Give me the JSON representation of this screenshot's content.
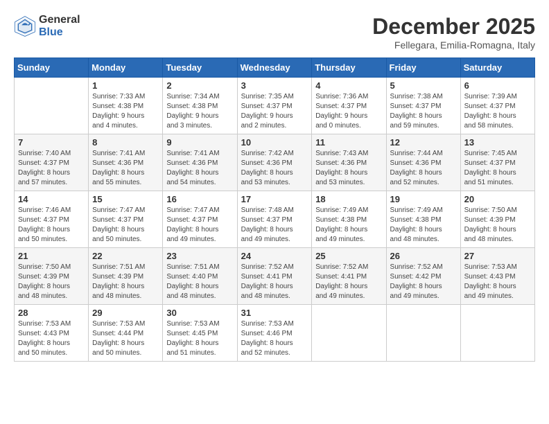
{
  "header": {
    "logo_general": "General",
    "logo_blue": "Blue",
    "month_title": "December 2025",
    "location": "Fellegara, Emilia-Romagna, Italy"
  },
  "weekdays": [
    "Sunday",
    "Monday",
    "Tuesday",
    "Wednesday",
    "Thursday",
    "Friday",
    "Saturday"
  ],
  "weeks": [
    [
      {
        "day": "",
        "info": ""
      },
      {
        "day": "1",
        "info": "Sunrise: 7:33 AM\nSunset: 4:38 PM\nDaylight: 9 hours\nand 4 minutes."
      },
      {
        "day": "2",
        "info": "Sunrise: 7:34 AM\nSunset: 4:38 PM\nDaylight: 9 hours\nand 3 minutes."
      },
      {
        "day": "3",
        "info": "Sunrise: 7:35 AM\nSunset: 4:37 PM\nDaylight: 9 hours\nand 2 minutes."
      },
      {
        "day": "4",
        "info": "Sunrise: 7:36 AM\nSunset: 4:37 PM\nDaylight: 9 hours\nand 0 minutes."
      },
      {
        "day": "5",
        "info": "Sunrise: 7:38 AM\nSunset: 4:37 PM\nDaylight: 8 hours\nand 59 minutes."
      },
      {
        "day": "6",
        "info": "Sunrise: 7:39 AM\nSunset: 4:37 PM\nDaylight: 8 hours\nand 58 minutes."
      }
    ],
    [
      {
        "day": "7",
        "info": "Sunrise: 7:40 AM\nSunset: 4:37 PM\nDaylight: 8 hours\nand 57 minutes."
      },
      {
        "day": "8",
        "info": "Sunrise: 7:41 AM\nSunset: 4:36 PM\nDaylight: 8 hours\nand 55 minutes."
      },
      {
        "day": "9",
        "info": "Sunrise: 7:41 AM\nSunset: 4:36 PM\nDaylight: 8 hours\nand 54 minutes."
      },
      {
        "day": "10",
        "info": "Sunrise: 7:42 AM\nSunset: 4:36 PM\nDaylight: 8 hours\nand 53 minutes."
      },
      {
        "day": "11",
        "info": "Sunrise: 7:43 AM\nSunset: 4:36 PM\nDaylight: 8 hours\nand 53 minutes."
      },
      {
        "day": "12",
        "info": "Sunrise: 7:44 AM\nSunset: 4:36 PM\nDaylight: 8 hours\nand 52 minutes."
      },
      {
        "day": "13",
        "info": "Sunrise: 7:45 AM\nSunset: 4:37 PM\nDaylight: 8 hours\nand 51 minutes."
      }
    ],
    [
      {
        "day": "14",
        "info": "Sunrise: 7:46 AM\nSunset: 4:37 PM\nDaylight: 8 hours\nand 50 minutes."
      },
      {
        "day": "15",
        "info": "Sunrise: 7:47 AM\nSunset: 4:37 PM\nDaylight: 8 hours\nand 50 minutes."
      },
      {
        "day": "16",
        "info": "Sunrise: 7:47 AM\nSunset: 4:37 PM\nDaylight: 8 hours\nand 49 minutes."
      },
      {
        "day": "17",
        "info": "Sunrise: 7:48 AM\nSunset: 4:37 PM\nDaylight: 8 hours\nand 49 minutes."
      },
      {
        "day": "18",
        "info": "Sunrise: 7:49 AM\nSunset: 4:38 PM\nDaylight: 8 hours\nand 49 minutes."
      },
      {
        "day": "19",
        "info": "Sunrise: 7:49 AM\nSunset: 4:38 PM\nDaylight: 8 hours\nand 48 minutes."
      },
      {
        "day": "20",
        "info": "Sunrise: 7:50 AM\nSunset: 4:39 PM\nDaylight: 8 hours\nand 48 minutes."
      }
    ],
    [
      {
        "day": "21",
        "info": "Sunrise: 7:50 AM\nSunset: 4:39 PM\nDaylight: 8 hours\nand 48 minutes."
      },
      {
        "day": "22",
        "info": "Sunrise: 7:51 AM\nSunset: 4:39 PM\nDaylight: 8 hours\nand 48 minutes."
      },
      {
        "day": "23",
        "info": "Sunrise: 7:51 AM\nSunset: 4:40 PM\nDaylight: 8 hours\nand 48 minutes."
      },
      {
        "day": "24",
        "info": "Sunrise: 7:52 AM\nSunset: 4:41 PM\nDaylight: 8 hours\nand 48 minutes."
      },
      {
        "day": "25",
        "info": "Sunrise: 7:52 AM\nSunset: 4:41 PM\nDaylight: 8 hours\nand 49 minutes."
      },
      {
        "day": "26",
        "info": "Sunrise: 7:52 AM\nSunset: 4:42 PM\nDaylight: 8 hours\nand 49 minutes."
      },
      {
        "day": "27",
        "info": "Sunrise: 7:53 AM\nSunset: 4:43 PM\nDaylight: 8 hours\nand 49 minutes."
      }
    ],
    [
      {
        "day": "28",
        "info": "Sunrise: 7:53 AM\nSunset: 4:43 PM\nDaylight: 8 hours\nand 50 minutes."
      },
      {
        "day": "29",
        "info": "Sunrise: 7:53 AM\nSunset: 4:44 PM\nDaylight: 8 hours\nand 50 minutes."
      },
      {
        "day": "30",
        "info": "Sunrise: 7:53 AM\nSunset: 4:45 PM\nDaylight: 8 hours\nand 51 minutes."
      },
      {
        "day": "31",
        "info": "Sunrise: 7:53 AM\nSunset: 4:46 PM\nDaylight: 8 hours\nand 52 minutes."
      },
      {
        "day": "",
        "info": ""
      },
      {
        "day": "",
        "info": ""
      },
      {
        "day": "",
        "info": ""
      }
    ]
  ]
}
